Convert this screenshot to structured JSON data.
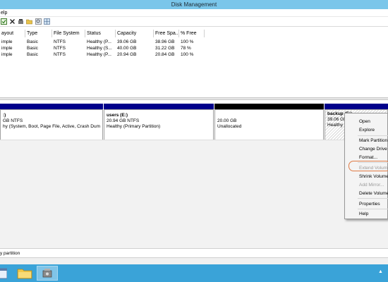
{
  "window": {
    "title": "Disk Management"
  },
  "menu": {
    "help": "elp"
  },
  "toolbar": {
    "icons": [
      "properties-icon",
      "delete-icon",
      "settings-icon",
      "folder-icon",
      "zoom-icon",
      "grid-icon"
    ]
  },
  "volume_list": {
    "columns": [
      "ayout",
      "Type",
      "File System",
      "Status",
      "Capacity",
      "Free Spa...",
      "% Free"
    ],
    "rows": [
      [
        "imple",
        "Basic",
        "NTFS",
        "Healthy (P...",
        "39.06 GB",
        "38.96 GB",
        "100 %"
      ],
      [
        "imple",
        "Basic",
        "NTFS",
        "Healthy (S...",
        "40.00 GB",
        "31.22 GB",
        "78 %"
      ],
      [
        "imple",
        "Basic",
        "NTFS",
        "Healthy (P...",
        "20.94 GB",
        "20.84 GB",
        "100 %"
      ]
    ]
  },
  "partitions": [
    {
      "name": ":)",
      "size": "GB NTFS",
      "status": "hy (System, Boot, Page File, Active, Crash Dump,"
    },
    {
      "name": "users  (E:)",
      "size": "20.94 GB NTFS",
      "status": "Healthy (Primary Partition)"
    },
    {
      "name": "",
      "size": "20.00 GB",
      "status": "Unallocated"
    },
    {
      "name": "backup  (F:)",
      "size": "39.06 GB",
      "status": "Healthy"
    }
  ],
  "legend": {
    "text": "y partition"
  },
  "context_menu": {
    "items": [
      "Open",
      "Explore",
      "Mark Partition",
      "Change Drive L",
      "Format...",
      "Extend Volume",
      "Shrink Volume",
      "Add Mirror...",
      "Delete Volume",
      "Properties",
      "Help"
    ],
    "disabled": [
      "Extend Volume",
      "Add Mirror..."
    ]
  },
  "taskbar": {
    "tray": "▲"
  },
  "colors": {
    "titlebar": "#7ac6ea",
    "taskbar": "#3aa3d8",
    "primary": "#00008b",
    "unallocated": "#000000",
    "highlight": "#e07b45"
  }
}
